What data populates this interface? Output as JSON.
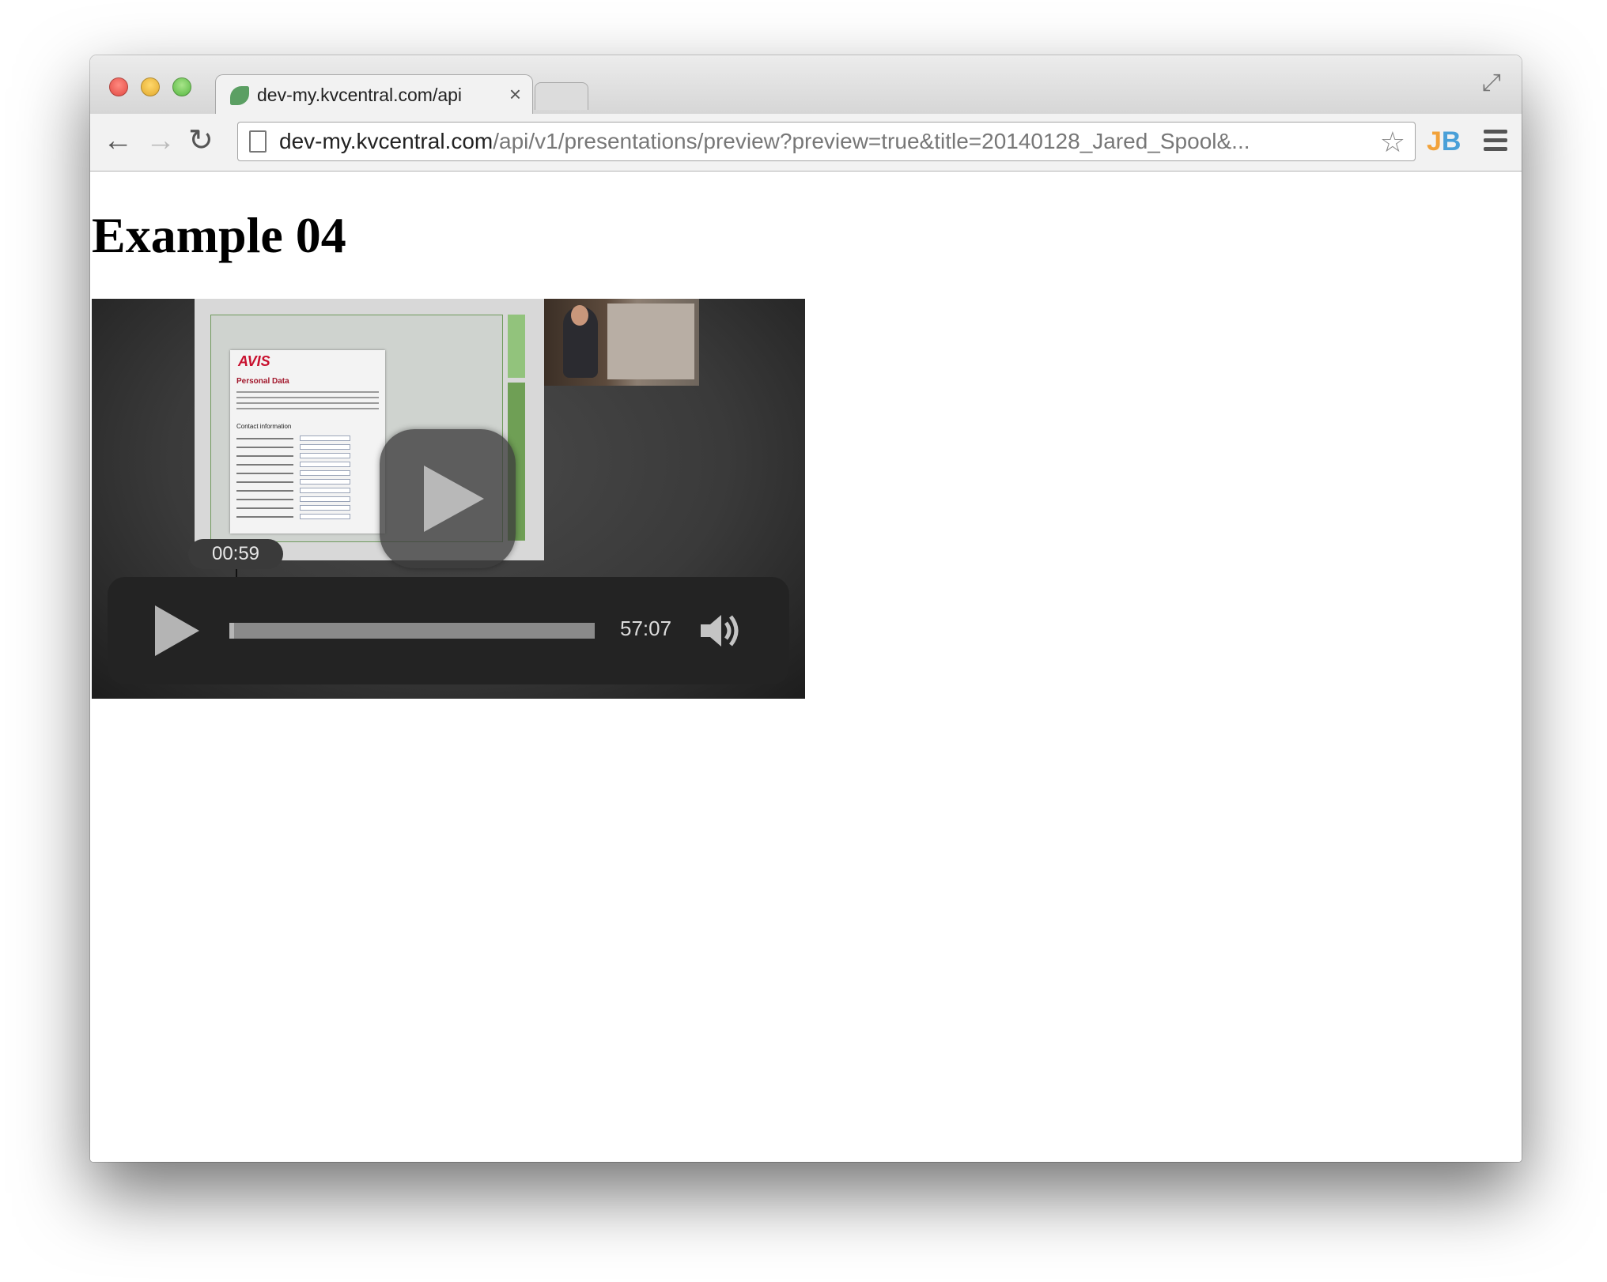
{
  "browser": {
    "tab_title": "dev-my.kvcentral.com/api",
    "tab_close": "×",
    "url_host": "dev-my.kvcentral.com",
    "url_path": "/api/v1/presentations/preview?preview=true&title=20140128_Jared_Spool&...",
    "extension_j": "J",
    "extension_b": "B",
    "back_glyph": "←",
    "forward_glyph": "→",
    "reload_glyph": "↻",
    "star_glyph": "☆",
    "fullscreen_glyph": "⤢"
  },
  "page": {
    "heading": "Example 04"
  },
  "player": {
    "slide": {
      "brand": "AVIS",
      "heading": "Personal Data",
      "section": "Contact information"
    },
    "hover_time": "00:59",
    "duration": "57:07",
    "progress_fraction": 0.013
  },
  "icons": [
    "close-icon",
    "minimize-icon",
    "maximize-icon",
    "back-icon",
    "forward-icon",
    "reload-icon",
    "page-icon",
    "star-icon",
    "menu-icon",
    "play-icon",
    "volume-icon",
    "fullscreen-icon"
  ]
}
